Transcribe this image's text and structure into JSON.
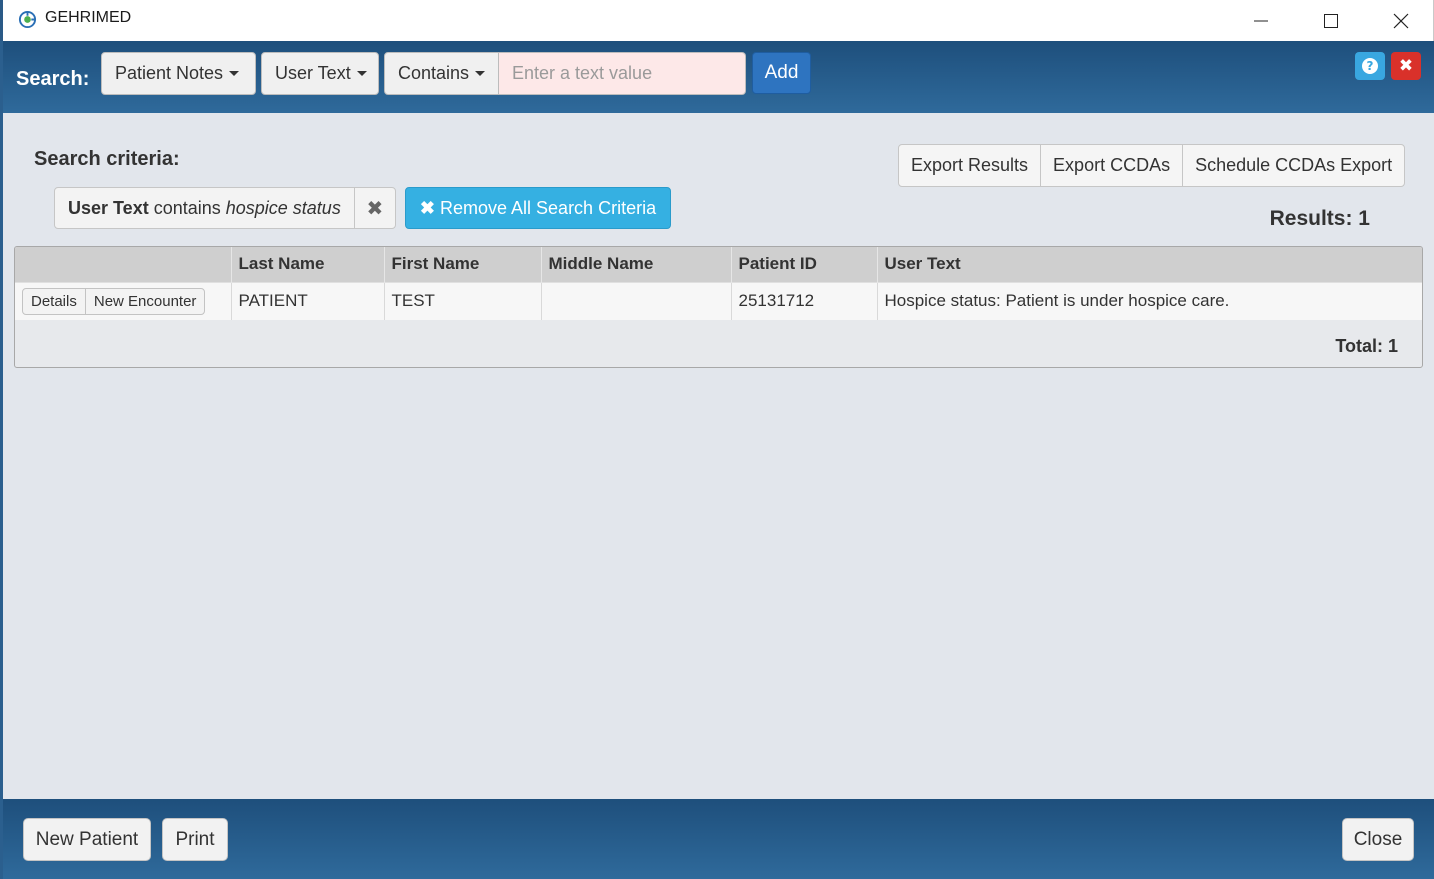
{
  "window": {
    "title": "GEHRIMED",
    "icon": "gehrimed-logo-icon"
  },
  "search": {
    "label": "Search:",
    "category": "Patient Notes",
    "field": "User Text",
    "operator": "Contains",
    "placeholder": "Enter a text value",
    "value": "",
    "add_label": "Add",
    "help_icon": "?",
    "close_icon": "✖"
  },
  "criteria": {
    "title": "Search criteria:",
    "items": [
      {
        "field": "User Text",
        "op": " contains ",
        "value": "hospice status"
      }
    ],
    "remove_all_icon": "✖",
    "remove_all_label": "Remove All Search Criteria"
  },
  "exports": {
    "results": "Export Results",
    "ccdas": "Export CCDAs",
    "schedule": "Schedule CCDAs Export"
  },
  "results_label": "Results: 1",
  "table": {
    "headers": [
      "",
      "Last Name",
      "First Name",
      "Middle Name",
      "Patient ID",
      "User Text"
    ],
    "rows": [
      {
        "actions": [
          "Details",
          "New Encounter"
        ],
        "last": "PATIENT",
        "first": "TEST",
        "middle": "",
        "id": "25131712",
        "text": "Hospice status: Patient is under hospice care."
      }
    ],
    "total": "Total: 1"
  },
  "footer": {
    "new_patient": "New Patient",
    "print": "Print",
    "close": "Close"
  },
  "colors": {
    "header_bg": "#2b5f8e",
    "add_button": "#2e74c0",
    "remove_all": "#35b0e2",
    "close_red": "#d9312a",
    "input_invalid": "#fde8e8"
  }
}
